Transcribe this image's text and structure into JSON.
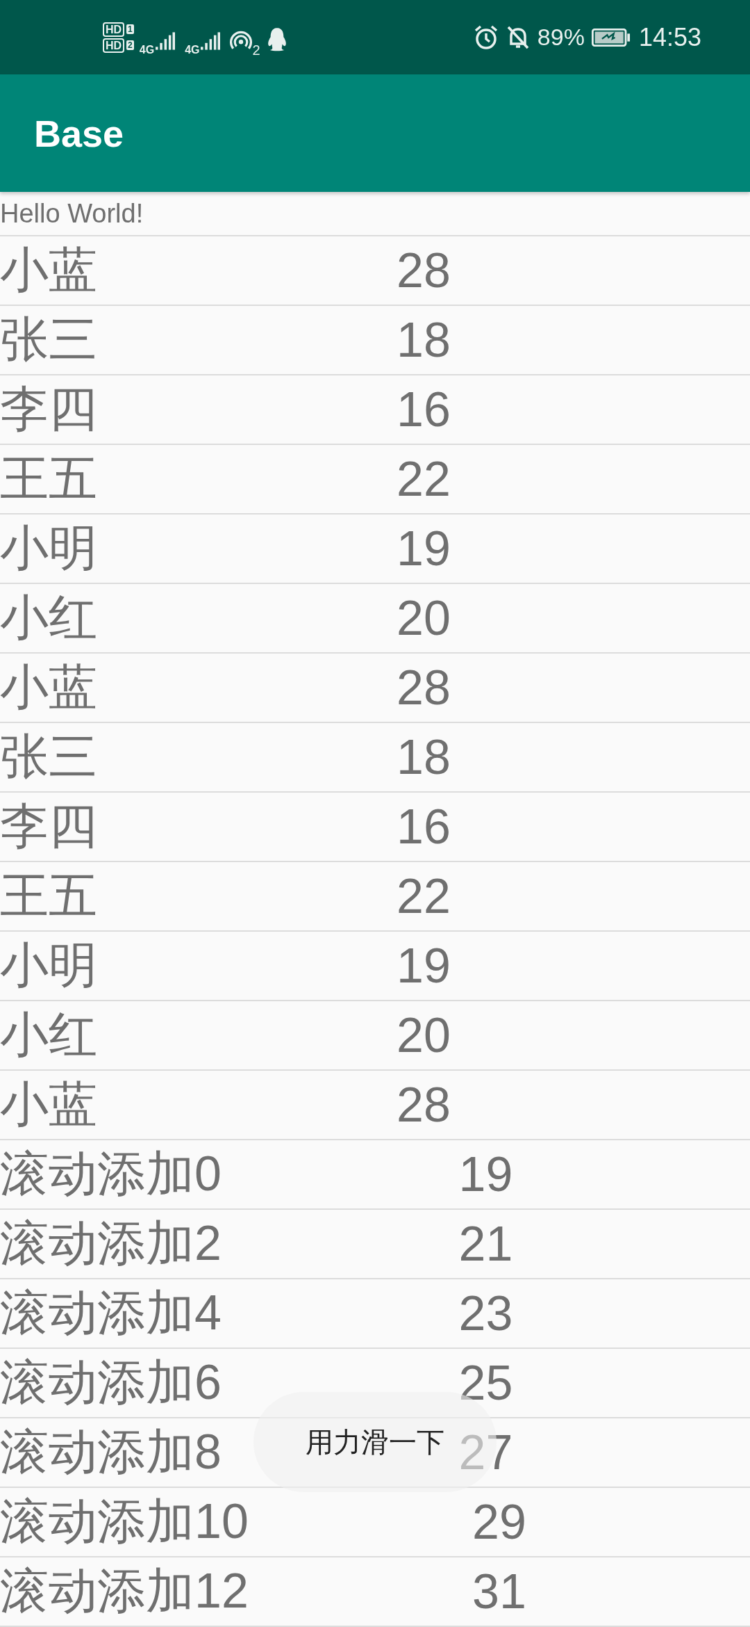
{
  "status_bar": {
    "sim_badges": [
      {
        "label": "HD",
        "slot": "1"
      },
      {
        "label": "HD",
        "slot": "2"
      }
    ],
    "networks": [
      "4G",
      "4G"
    ],
    "hotspot_count": "2",
    "battery": "89%",
    "time": "14:53"
  },
  "app_bar": {
    "title": "Base"
  },
  "header_text": "Hello World!",
  "rows": [
    {
      "name": "小蓝",
      "age": "28"
    },
    {
      "name": "张三",
      "age": "18"
    },
    {
      "name": "李四",
      "age": "16"
    },
    {
      "name": "王五",
      "age": "22"
    },
    {
      "name": "小明",
      "age": "19"
    },
    {
      "name": "小红",
      "age": "20"
    },
    {
      "name": "小蓝",
      "age": "28"
    },
    {
      "name": "张三",
      "age": "18"
    },
    {
      "name": "李四",
      "age": "16"
    },
    {
      "name": "王五",
      "age": "22"
    },
    {
      "name": "小明",
      "age": "19"
    },
    {
      "name": "小红",
      "age": "20"
    },
    {
      "name": "小蓝",
      "age": "28"
    },
    {
      "name": "滚动添加0",
      "age": "19"
    },
    {
      "name": "滚动添加2",
      "age": "21"
    },
    {
      "name": "滚动添加4",
      "age": "23"
    },
    {
      "name": "滚动添加6",
      "age": "25"
    },
    {
      "name": "滚动添加8",
      "age": "27"
    },
    {
      "name": "滚动添加10",
      "age": "29"
    },
    {
      "name": "滚动添加12",
      "age": "31"
    }
  ],
  "toast": {
    "message": "用力滑一下"
  }
}
